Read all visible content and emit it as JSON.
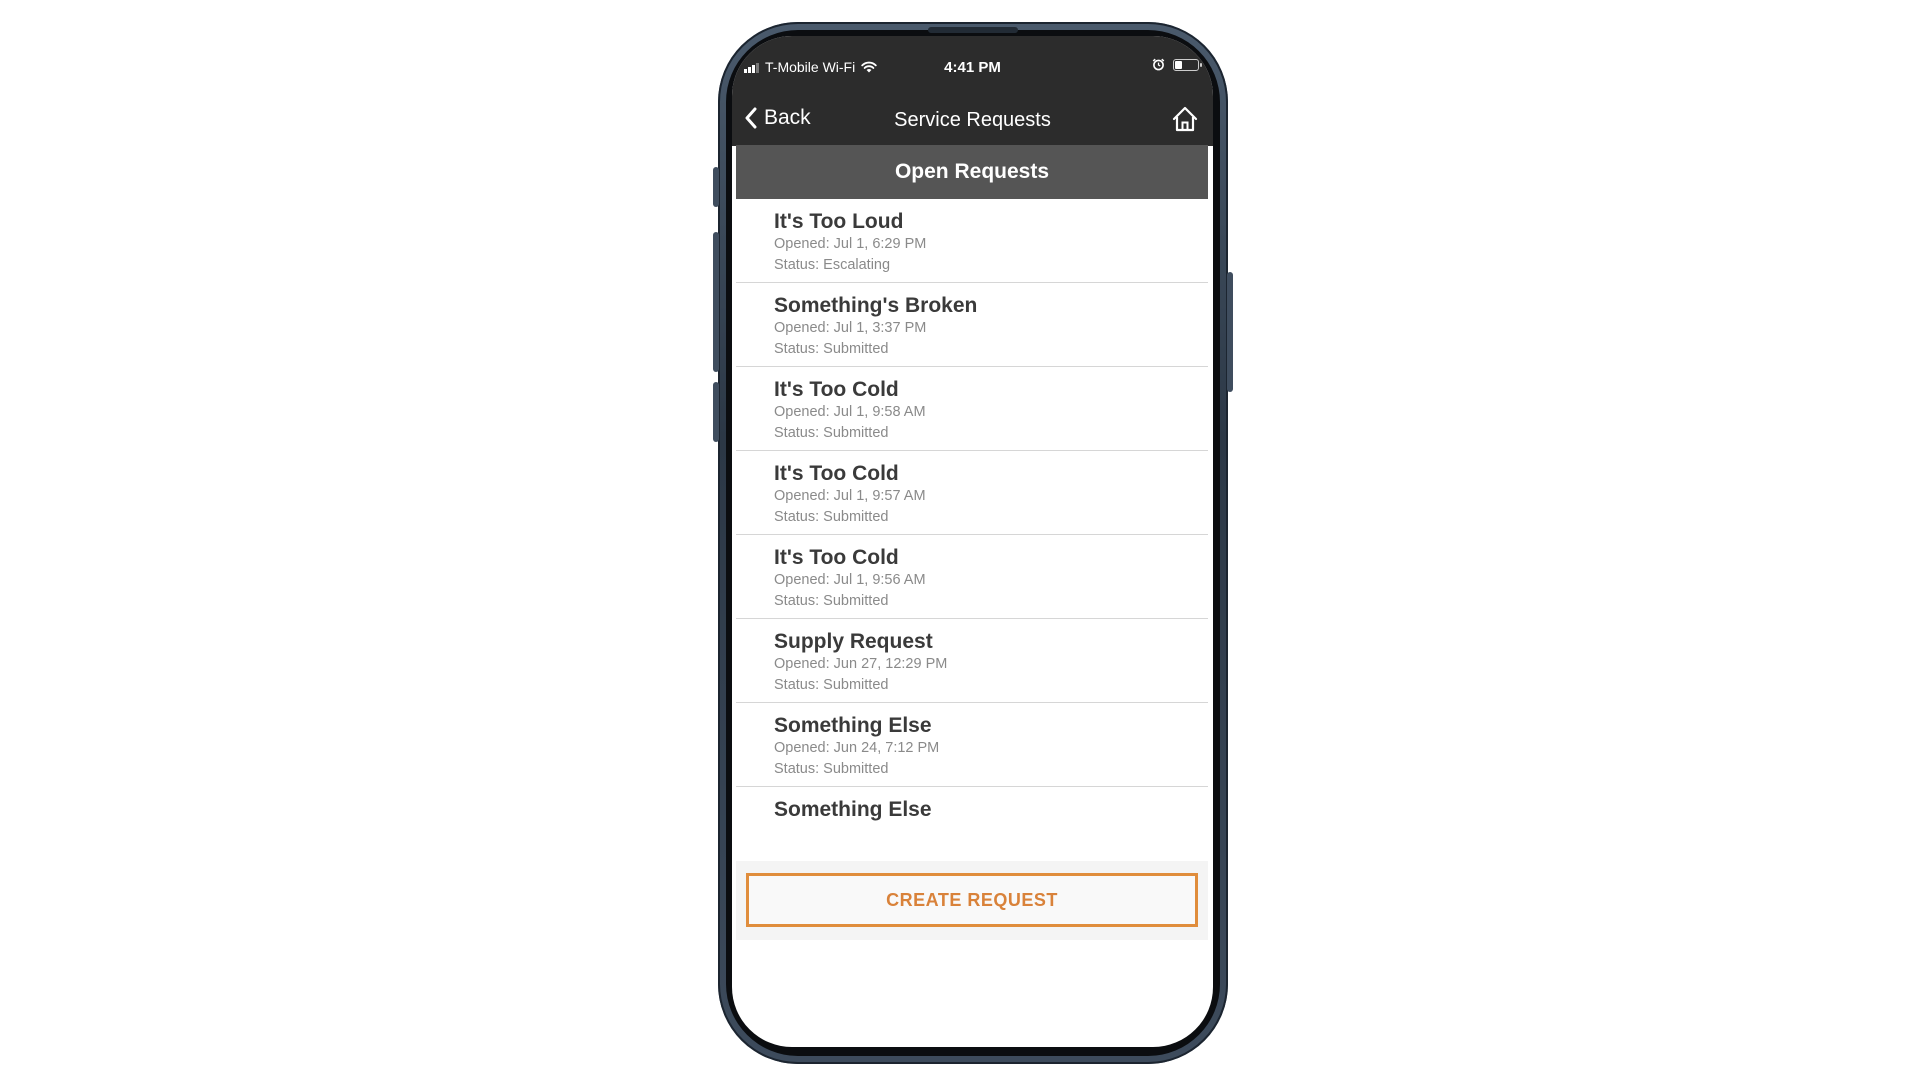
{
  "status_bar": {
    "carrier": "T-Mobile Wi-Fi",
    "time": "4:41 PM",
    "battery_level": 0.35
  },
  "nav": {
    "back_label": "Back",
    "title": "Service Requests"
  },
  "section": {
    "title": "Open Requests"
  },
  "requests": [
    {
      "title": "It's Too Loud",
      "opened": "Opened: Jul 1, 6:29 PM",
      "status": "Status: Escalating"
    },
    {
      "title": "Something's Broken",
      "opened": "Opened: Jul 1, 3:37 PM",
      "status": "Status: Submitted"
    },
    {
      "title": "It's Too Cold",
      "opened": "Opened: Jul 1, 9:58 AM",
      "status": "Status: Submitted"
    },
    {
      "title": "It's Too Cold",
      "opened": "Opened: Jul 1, 9:57 AM",
      "status": "Status: Submitted"
    },
    {
      "title": "It's Too Cold",
      "opened": "Opened: Jul 1, 9:56 AM",
      "status": "Status: Submitted"
    },
    {
      "title": "Supply Request",
      "opened": "Opened: Jun 27, 12:29 PM",
      "status": "Status: Submitted"
    },
    {
      "title": "Something Else",
      "opened": "Opened: Jun 24, 7:12 PM",
      "status": "Status: Submitted"
    },
    {
      "title": "Something Else"
    }
  ],
  "footer": {
    "create_label": "CREATE REQUEST"
  },
  "colors": {
    "accent": "#e08d3c",
    "header_bg": "#2c2c2c",
    "section_bg": "#555555"
  }
}
